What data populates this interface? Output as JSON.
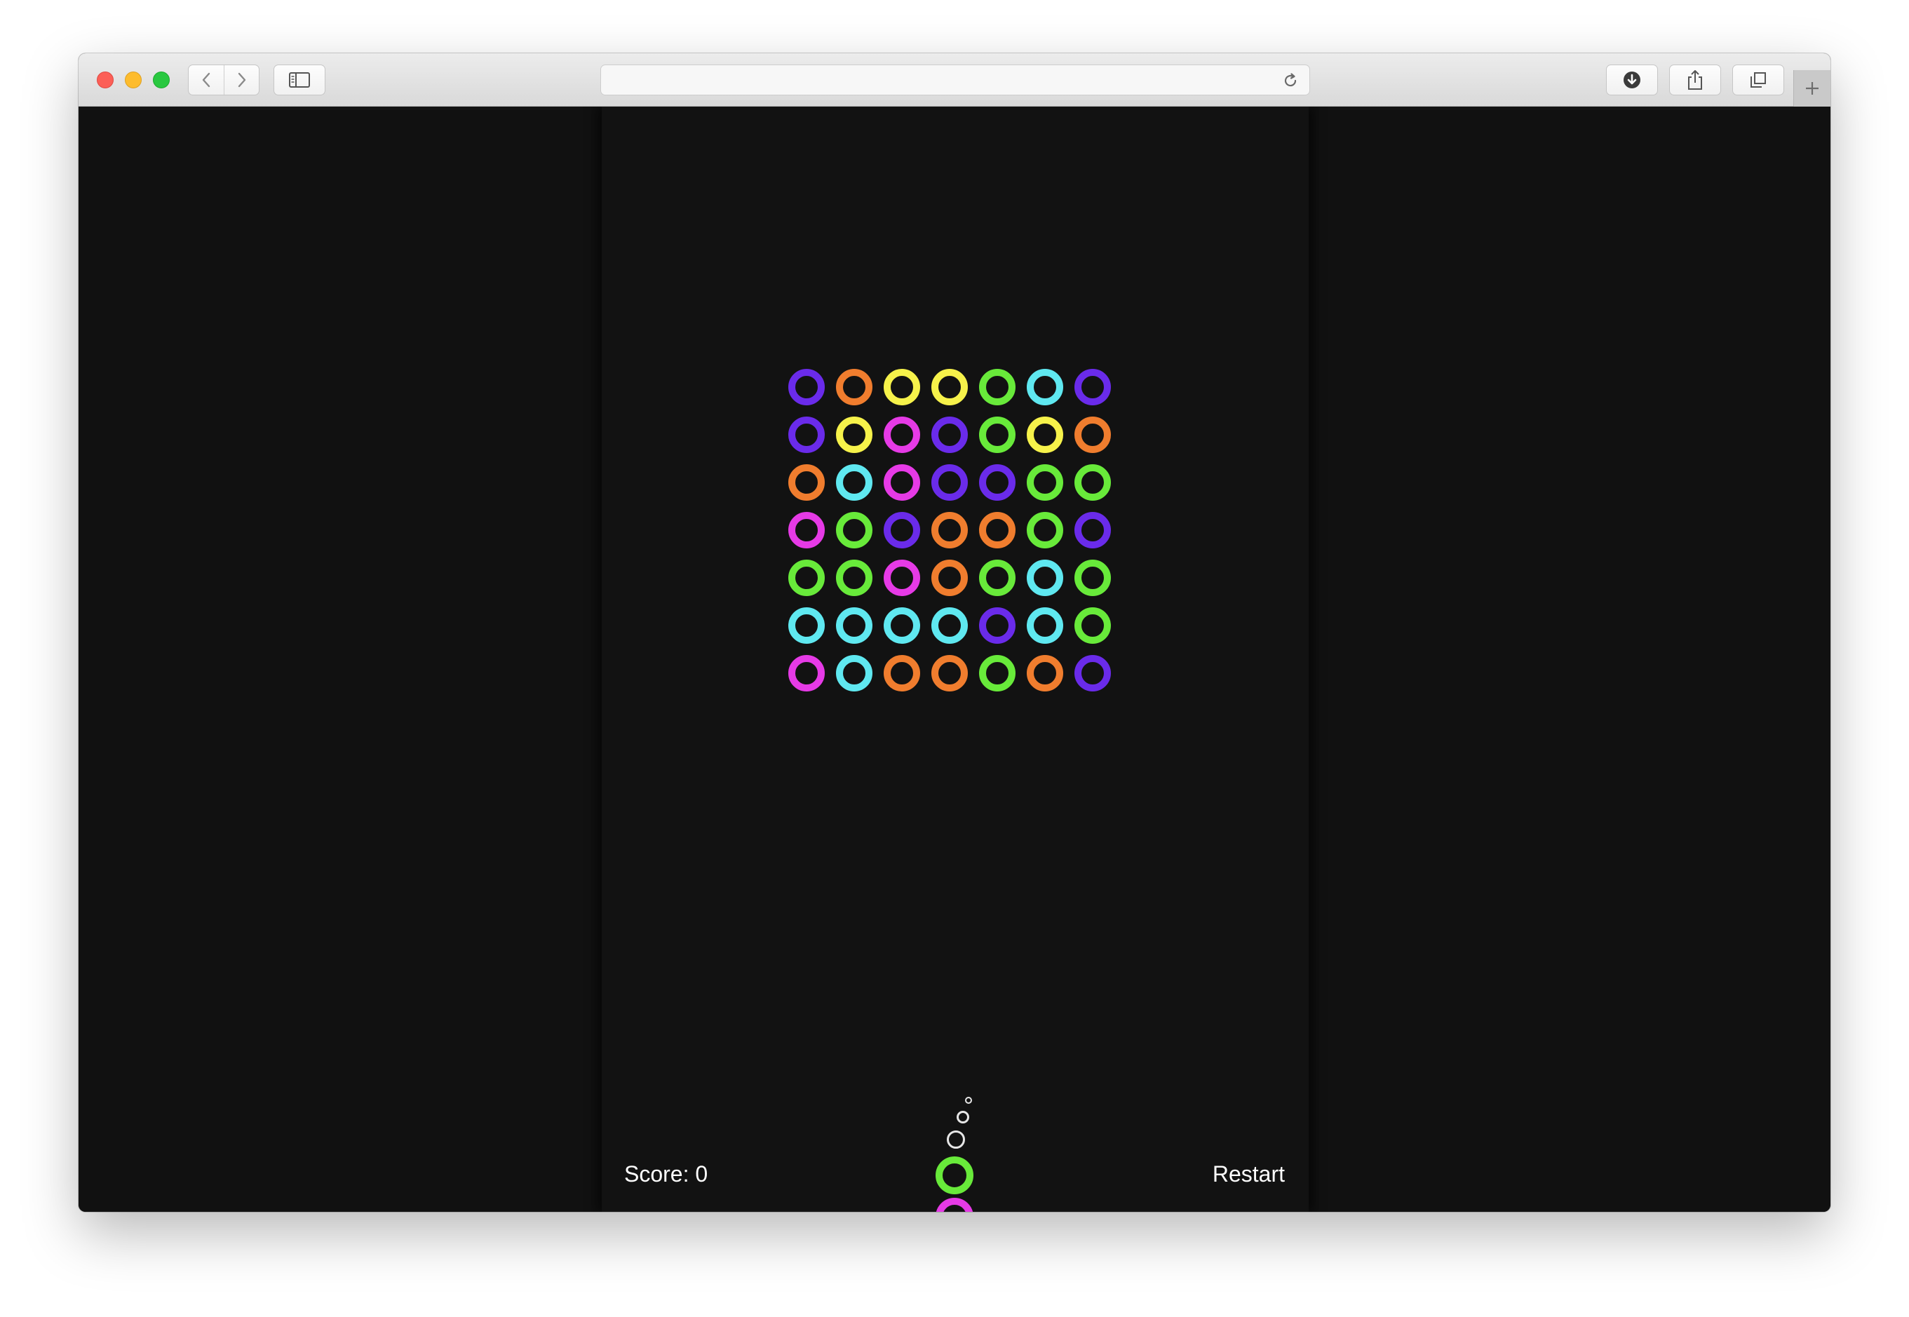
{
  "browser": {
    "url": ""
  },
  "colors": {
    "purple": "#6a2bea",
    "orange": "#f07d2e",
    "yellow": "#f6f24a",
    "green": "#68ea3a",
    "cyan": "#5fe8f0",
    "magenta": "#e63ae6",
    "background": "#121212",
    "aim": "#e6e6e6"
  },
  "grid": [
    [
      "purple",
      "orange",
      "yellow",
      "yellow",
      "green",
      "cyan",
      "purple"
    ],
    [
      "purple",
      "yellow",
      "magenta",
      "purple",
      "green",
      "yellow",
      "orange"
    ],
    [
      "orange",
      "cyan",
      "magenta",
      "purple",
      "purple",
      "green",
      "green"
    ],
    [
      "magenta",
      "green",
      "purple",
      "orange",
      "orange",
      "green",
      "purple"
    ],
    [
      "green",
      "green",
      "magenta",
      "orange",
      "green",
      "cyan",
      "green"
    ],
    [
      "cyan",
      "cyan",
      "cyan",
      "cyan",
      "purple",
      "cyan",
      "green"
    ],
    [
      "magenta",
      "cyan",
      "orange",
      "orange",
      "green",
      "orange",
      "purple"
    ]
  ],
  "shooter": {
    "current": "green",
    "next": "magenta"
  },
  "hud": {
    "score_label": "Score: 0",
    "restart_label": "Restart"
  }
}
